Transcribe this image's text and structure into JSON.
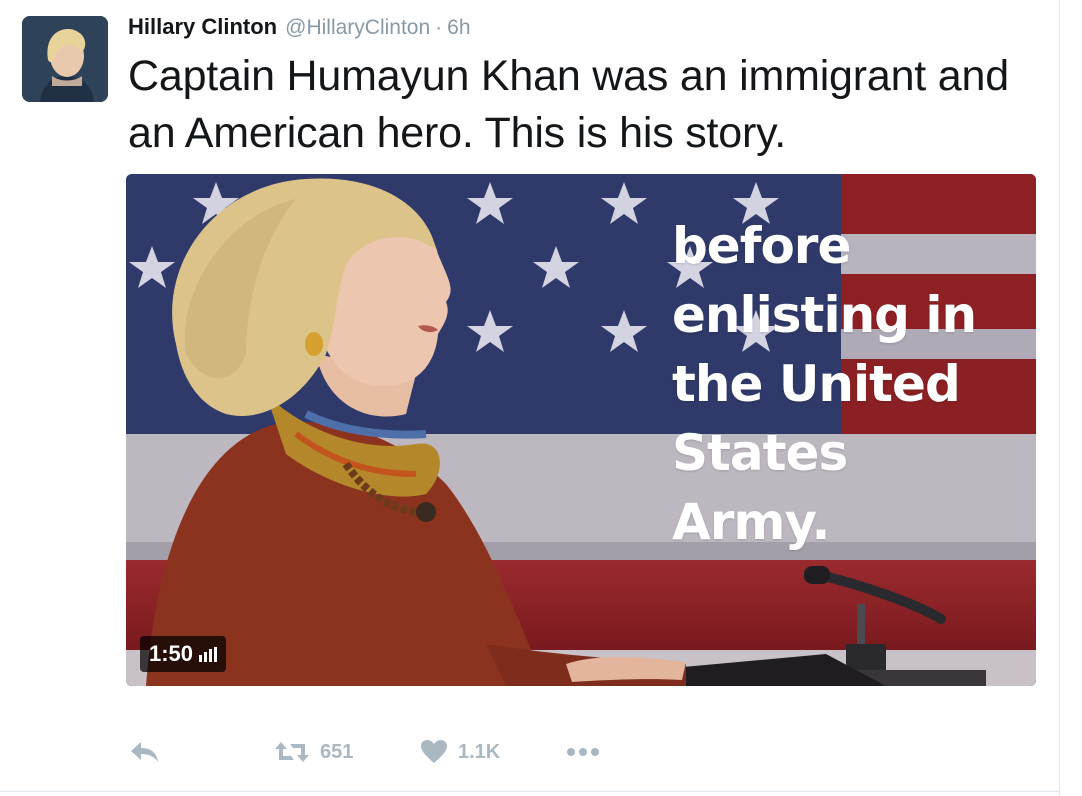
{
  "tweet": {
    "author": {
      "display_name": "Hillary Clinton",
      "handle": "@HillaryClinton",
      "separator": "·",
      "timestamp": "6h"
    },
    "text": "Captain Humayun Khan was an immigrant and an American hero. This is his story.",
    "media": {
      "type": "video",
      "overlay_lines": [
        "before",
        "enlisting in",
        "the United",
        "States",
        "Army."
      ],
      "duration": "1:50"
    },
    "actions": {
      "reply_icon": "reply-icon",
      "retweet_icon": "retweet-icon",
      "retweet_count": "651",
      "like_icon": "heart-icon",
      "like_count": "1.1K",
      "more_icon": "more-icon"
    }
  },
  "colors": {
    "text_primary": "#14171a",
    "text_secondary": "#8899a6",
    "action_gray": "#aab8c2",
    "flag_blue": "#2e3660",
    "flag_red": "#8a1f22"
  }
}
